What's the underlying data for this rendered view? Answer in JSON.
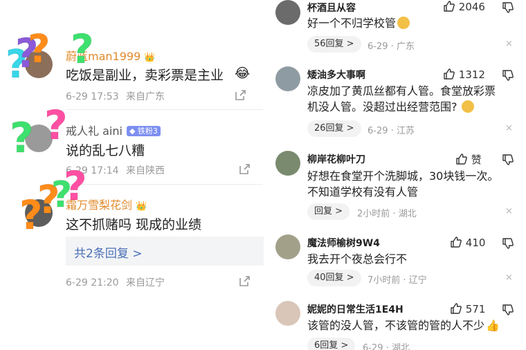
{
  "left": {
    "comments": [
      {
        "name": "蔚蓝man1999",
        "text": "吃饭是副业，卖彩票是主业",
        "time": "6-29 17:53",
        "source": "来自广东"
      },
      {
        "name": "戒人礼 aini",
        "badge": "铁粉3",
        "text": "说的乱七八糟",
        "time": "6-29 17:14",
        "source": "来自陕西"
      },
      {
        "name": "霜万雪梨花剑",
        "text": "这不抓赌吗 现成的业绩",
        "time": "6-29 21:20",
        "source": "来自辽宁",
        "more_replies": "共2条回复 >"
      }
    ],
    "question_marks": [
      "?",
      "?",
      "?",
      "?",
      "?",
      "?",
      "?",
      "?",
      "?",
      "?",
      "?",
      "?"
    ],
    "colors": {
      "name_orange": "#e08a2c",
      "link_blue": "#4a6fb5",
      "q_orange": "#ff8c1a",
      "q_pink": "#ff4fa3",
      "q_green": "#3ee06e",
      "q_cyan": "#38d6e8",
      "q_purple": "#8b5ad8"
    }
  },
  "right": {
    "comments": [
      {
        "name": "杯酒且从容",
        "likes": "2046",
        "lines": [
          "好一个不归学校管"
        ],
        "reply_label": "56回复 >",
        "time": "6-29",
        "location": "广东"
      },
      {
        "name": "矮油多大事啊",
        "likes": "1312",
        "lines": [
          "凉皮加了黄瓜丝都有人管。食堂放彩票",
          "机没人管。没超过出经营范围?"
        ],
        "reply_label": "26回复 >",
        "time": "6-29",
        "location": "江苏"
      },
      {
        "name": "柳岸花柳叶刀",
        "likes": "赞",
        "lines": [
          "好想在食堂开个洗脚城，30块钱一次。",
          "不知道学校有没有人管"
        ],
        "reply_label": "回复 >",
        "time": "2小时前",
        "location": "湖北"
      },
      {
        "name": "魔法师榆树9W4",
        "likes": "410",
        "lines": [
          "我去开个夜总会行不"
        ],
        "reply_label": "40回复 >",
        "time": "7小时前",
        "location": "辽宁"
      },
      {
        "name": "妮妮的日常生活1E4H",
        "likes": "571",
        "lines": [
          "该管的没人管，不该管的管的人不少"
        ],
        "reply_label": "6回复 >",
        "time": "6-29",
        "location": "湖北"
      }
    ],
    "close_symbol": "×",
    "dot_separator": "·"
  }
}
